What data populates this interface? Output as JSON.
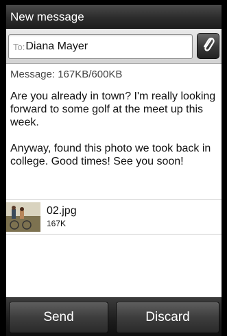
{
  "header": {
    "title": "New message"
  },
  "recipient": {
    "label": "To:",
    "value": "Diana Mayer"
  },
  "attach_button": {
    "icon": "paperclip-icon"
  },
  "message_size": "Message: 167KB/600KB",
  "body": {
    "paragraph_1": "Are you already in town? I'm really looking forward to some golf at the meet up this week.",
    "paragraph_2": "Anyway, found this photo we took back in college. Good times! See you soon!"
  },
  "attachment": {
    "name": "02.jpg",
    "size": "167K",
    "thumbnail": "photo-thumbnail"
  },
  "actions": {
    "send": "Send",
    "discard": "Discard"
  }
}
